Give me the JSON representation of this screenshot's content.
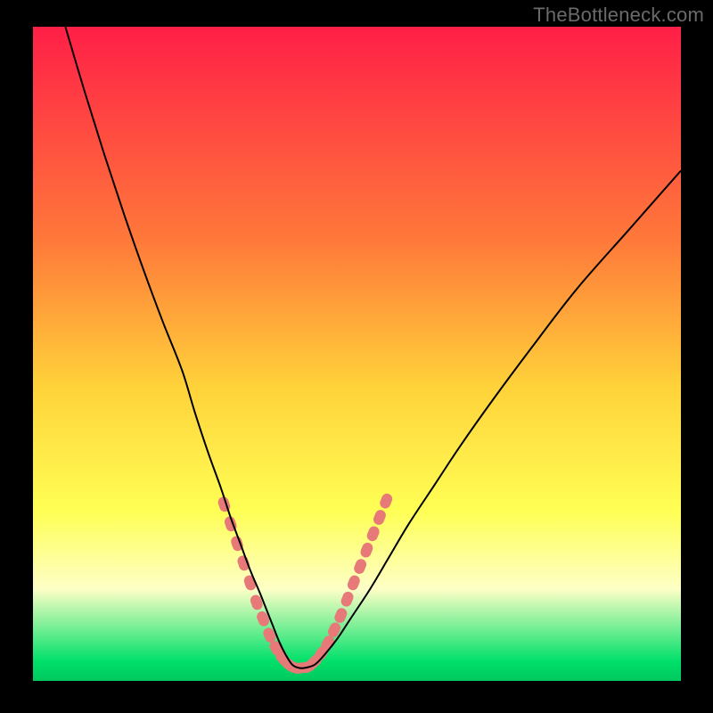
{
  "watermark": "TheBottleneck.com",
  "colors": {
    "black": "#000000",
    "curve": "#000000",
    "marker_fill": "#e77a78",
    "grad_top": "#ff1f47",
    "grad_mid1": "#ff7a3a",
    "grad_mid2": "#ffd23a",
    "grad_yellow": "#ffff55",
    "grad_cream": "#fdffc6",
    "grad_green": "#00e06a"
  },
  "chart_data": {
    "type": "line",
    "title": "",
    "xlabel": "",
    "ylabel": "",
    "xlim": [
      0,
      100
    ],
    "ylim": [
      0,
      100
    ],
    "x": [
      5,
      8,
      11,
      14,
      17,
      20,
      23,
      25,
      27,
      29,
      30.5,
      32,
      33.5,
      35,
      36,
      37,
      38,
      39,
      40,
      41,
      42,
      43.5,
      45,
      47,
      49,
      52,
      55,
      58,
      62,
      66,
      71,
      77,
      84,
      92,
      100
    ],
    "y": [
      100,
      90,
      80.5,
      71.5,
      63,
      55,
      47.5,
      41,
      35,
      29.5,
      25,
      21,
      17,
      13.5,
      11,
      8.5,
      6,
      4,
      2.5,
      2,
      2,
      2.5,
      4,
      6.5,
      9.5,
      14,
      19,
      24,
      30,
      36,
      43,
      51,
      60,
      69,
      78
    ],
    "series": [
      {
        "name": "bottleneck-curve",
        "style": "line",
        "color": "#000000"
      }
    ],
    "markers": {
      "name": "highlight-band",
      "style": "capsule",
      "color": "#e77a78",
      "points": [
        {
          "x": 29.5,
          "y": 27.0
        },
        {
          "x": 30.5,
          "y": 24.0
        },
        {
          "x": 31.5,
          "y": 21.0
        },
        {
          "x": 32.5,
          "y": 18.0
        },
        {
          "x": 33.5,
          "y": 15.0
        },
        {
          "x": 34.5,
          "y": 12.0
        },
        {
          "x": 35.5,
          "y": 9.5
        },
        {
          "x": 36.5,
          "y": 7.0
        },
        {
          "x": 37.5,
          "y": 5.0
        },
        {
          "x": 38.5,
          "y": 3.5
        },
        {
          "x": 39.5,
          "y": 2.5
        },
        {
          "x": 40.5,
          "y": 2.0
        },
        {
          "x": 41.5,
          "y": 2.0
        },
        {
          "x": 42.5,
          "y": 2.2
        },
        {
          "x": 43.5,
          "y": 3.0
        },
        {
          "x": 44.5,
          "y": 4.2
        },
        {
          "x": 45.5,
          "y": 5.8
        },
        {
          "x": 46.5,
          "y": 7.8
        },
        {
          "x": 47.5,
          "y": 10.0
        },
        {
          "x": 48.5,
          "y": 12.5
        },
        {
          "x": 49.5,
          "y": 15.0
        },
        {
          "x": 50.5,
          "y": 17.5
        },
        {
          "x": 51.5,
          "y": 20.0
        },
        {
          "x": 52.5,
          "y": 22.5
        },
        {
          "x": 53.5,
          "y": 25.0
        },
        {
          "x": 54.5,
          "y": 27.5
        }
      ]
    },
    "background_gradient": [
      {
        "stop": 0.0,
        "color": "#ff1f47"
      },
      {
        "stop": 0.33,
        "color": "#ff7a3a"
      },
      {
        "stop": 0.55,
        "color": "#ffd23a"
      },
      {
        "stop": 0.74,
        "color": "#ffff55"
      },
      {
        "stop": 0.86,
        "color": "#fdffc6"
      },
      {
        "stop": 0.97,
        "color": "#00e06a"
      },
      {
        "stop": 1.0,
        "color": "#00c85e"
      }
    ]
  }
}
